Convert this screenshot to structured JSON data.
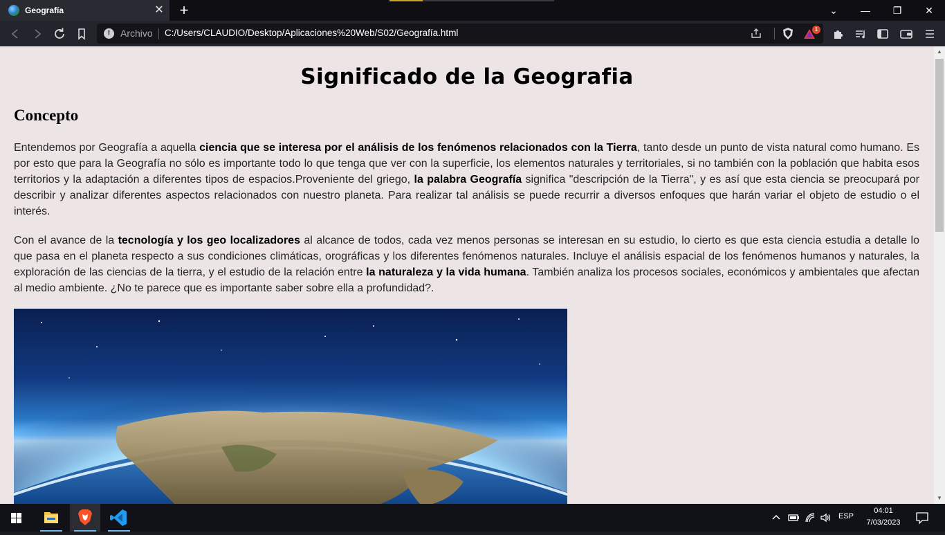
{
  "browser": {
    "tab": {
      "title": "Geografía",
      "favicon": "globe-icon",
      "close": "✕"
    },
    "new_tab": "+",
    "window_controls": {
      "chevron": "⌄",
      "minimize": "—",
      "restore": "❐",
      "close": "✕"
    },
    "address": {
      "scheme_label": "Archivo",
      "url": "C:/Users/CLAUDIO/Desktop/Aplicaciones%20Web/S02/Geografía.html",
      "rewards_badge": "1"
    }
  },
  "page": {
    "title": "Significado de la Geografia",
    "section": "Concepto",
    "p1": [
      {
        "t": "Entendemos por Geografía a aquella ",
        "b": false
      },
      {
        "t": "ciencia que se interesa por el análisis de los fenómenos relacionados con la Tierra",
        "b": true
      },
      {
        "t": ", tanto desde un punto de vista natural como humano. Es por esto que para la Geografía no sólo es importante todo lo que tenga que ver con la superficie, los elementos naturales y territoriales, si no también con la población que habita esos territorios y la adaptación a diferentes tipos de espacios.Proveniente del griego, ",
        "b": false
      },
      {
        "t": "la palabra Geografía",
        "b": true
      },
      {
        "t": " significa \"descripción de la Tierra\", y es así que esta ciencia se preocupará por describir y analizar diferentes aspectos relacionados con nuestro planeta. Para realizar tal análisis se puede recurrir a diversos enfoques que harán variar el objeto de estudio o el interés.",
        "b": false
      }
    ],
    "p2": [
      {
        "t": "Con el avance de la ",
        "b": false
      },
      {
        "t": "tecnología y los geo localizadores",
        "b": true
      },
      {
        "t": " al alcance de todos, cada vez menos personas se interesan en su estudio, lo cierto es que esta ciencia estudia a detalle lo que pasa en el planeta respecto a sus condiciones climáticas, orográficas y los diferentes fenómenos naturales. Incluye el análisis espacial de los fenómenos humanos y naturales, la exploración de las ciencias de la tierra, y el estudio de la relación entre ",
        "b": false
      },
      {
        "t": "la naturaleza y la vida humana",
        "b": true
      },
      {
        "t": ". También analiza los procesos sociales, económicos y ambientales que afectan al medio ambiente. ¿No te parece que es importante saber sobre ella a profundidad?.",
        "b": false
      }
    ]
  },
  "taskbar": {
    "apps": [
      "file-explorer-icon",
      "brave-browser-icon",
      "vscode-icon"
    ],
    "language": "ESP",
    "time": "04:01",
    "date": "7/03/2023"
  },
  "colors": {
    "page_bg": "#ece4e5",
    "chrome_bg": "#24242c",
    "taskbar_bg": "#101218"
  }
}
